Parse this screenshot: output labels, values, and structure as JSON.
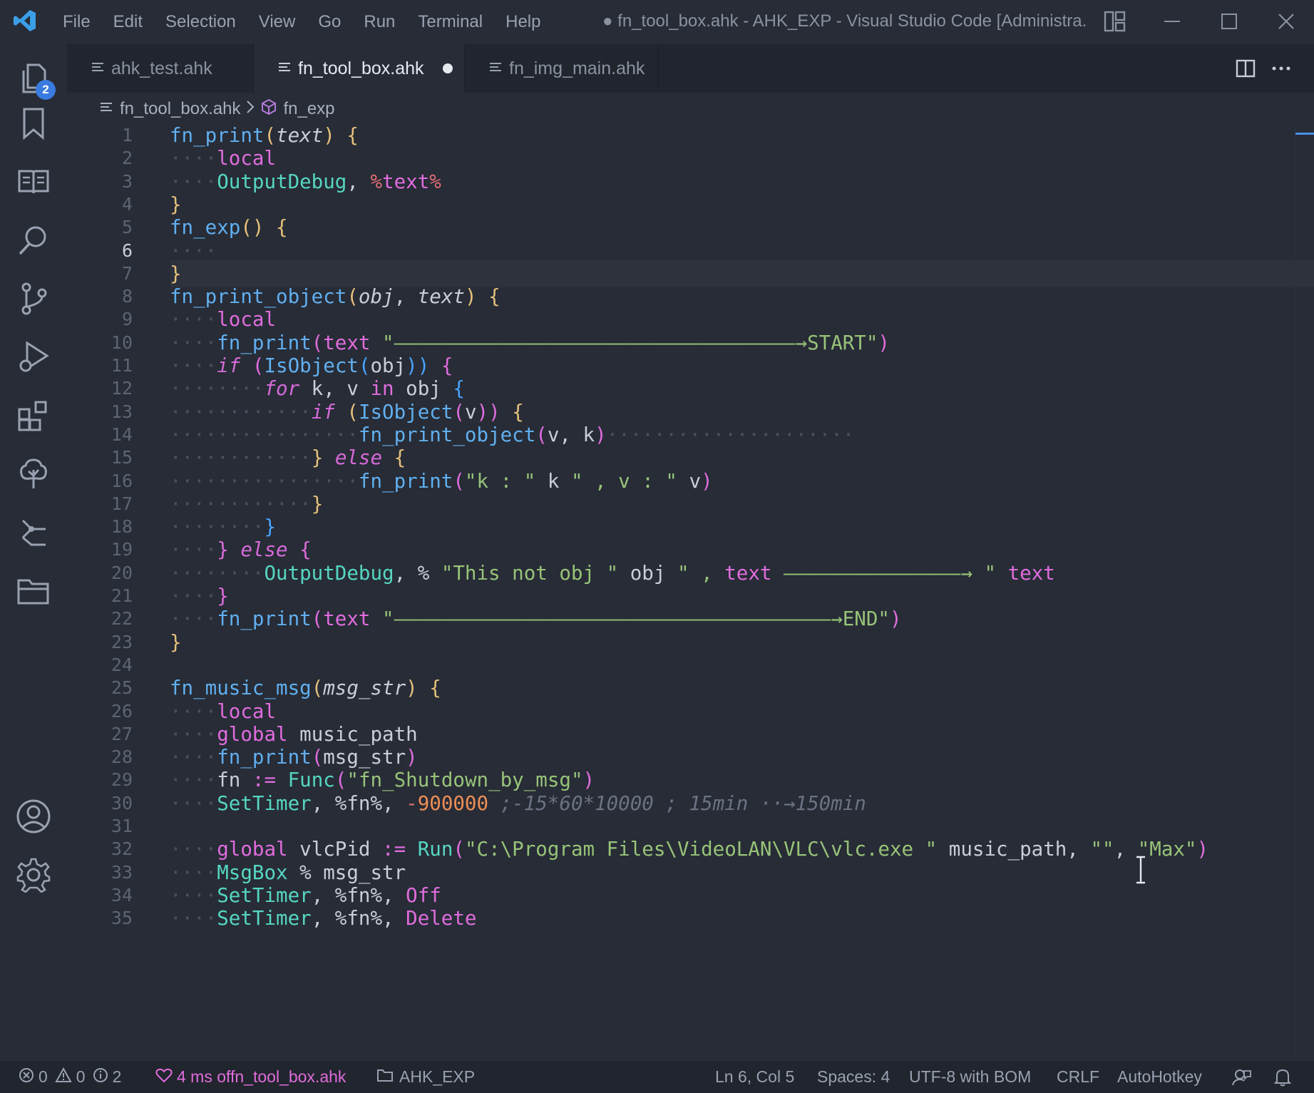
{
  "menu": [
    "File",
    "Edit",
    "Selection",
    "View",
    "Go",
    "Run",
    "Terminal",
    "Help"
  ],
  "window_title": "● fn_tool_box.ahk - AHK_EXP - Visual Studio Code [Administra...",
  "activity_badge": "2",
  "tabs": [
    {
      "label": "ahk_test.ahk",
      "dirty": false,
      "active": false
    },
    {
      "label": "fn_tool_box.ahk",
      "dirty": true,
      "active": true
    },
    {
      "label": "fn_img_main.ahk",
      "dirty": true,
      "active": false
    }
  ],
  "breadcrumb": {
    "file": "fn_tool_box.ahk",
    "symbol": "fn_exp"
  },
  "editor": {
    "current_line": 6,
    "lines": [
      {
        "n": "1",
        "segs": [
          [
            "fn_print",
            "fn"
          ],
          [
            "(",
            "pb"
          ],
          [
            "text",
            "it"
          ],
          [
            ")",
            "pb"
          ],
          [
            " ",
            ""
          ],
          [
            "{",
            "by"
          ]
        ]
      },
      {
        "n": "2",
        "segs": [
          [
            "····",
            "ws"
          ],
          [
            "local",
            "kw"
          ]
        ]
      },
      {
        "n": "3",
        "segs": [
          [
            "····",
            "ws"
          ],
          [
            "OutputDebug",
            "cmd"
          ],
          [
            ", ",
            ""
          ],
          [
            "%",
            "pn"
          ],
          [
            "text",
            "kw"
          ],
          [
            "%",
            "pn"
          ]
        ]
      },
      {
        "n": "4",
        "segs": [
          [
            "}",
            "by"
          ]
        ]
      },
      {
        "n": "5",
        "segs": [
          [
            "fn_exp",
            "fn"
          ],
          [
            "()",
            "pb"
          ],
          [
            " ",
            ""
          ],
          [
            "{",
            "by"
          ]
        ]
      },
      {
        "n": "6",
        "segs": [
          [
            "····",
            "ws"
          ]
        ]
      },
      {
        "n": "7",
        "segs": [
          [
            "}",
            "by"
          ]
        ]
      },
      {
        "n": "8",
        "segs": [
          [
            "fn_print_object",
            "fn"
          ],
          [
            "(",
            "pb"
          ],
          [
            "obj",
            "it"
          ],
          [
            ", ",
            ""
          ],
          [
            "text",
            "it"
          ],
          [
            ")",
            "pb"
          ],
          [
            " ",
            ""
          ],
          [
            "{",
            "by"
          ]
        ]
      },
      {
        "n": "9",
        "segs": [
          [
            "····",
            "ws"
          ],
          [
            "local",
            "kw"
          ]
        ]
      },
      {
        "n": "10",
        "segs": [
          [
            "····",
            "ws"
          ],
          [
            "fn_print",
            "fn"
          ],
          [
            "(",
            "pm"
          ],
          [
            "text ",
            "kw"
          ],
          [
            "\"——————————————————————————————————→START\"",
            "str"
          ],
          [
            ")",
            "pm"
          ]
        ]
      },
      {
        "n": "11",
        "segs": [
          [
            "····",
            "ws"
          ],
          [
            "if",
            "kwi"
          ],
          [
            " ",
            ""
          ],
          [
            "(",
            "pm"
          ],
          [
            "IsObject",
            "fn"
          ],
          [
            "(",
            "bb"
          ],
          [
            "obj",
            "id"
          ],
          [
            "))",
            "bb"
          ],
          [
            " ",
            ""
          ],
          [
            "{",
            "pm"
          ]
        ]
      },
      {
        "n": "12",
        "segs": [
          [
            "········",
            "ws"
          ],
          [
            "for",
            "kwi"
          ],
          [
            " k, v ",
            ""
          ],
          [
            "in",
            "kw"
          ],
          [
            " obj ",
            ""
          ],
          [
            "{",
            "bb"
          ]
        ]
      },
      {
        "n": "13",
        "segs": [
          [
            "············",
            "ws"
          ],
          [
            "if",
            "kwi"
          ],
          [
            " ",
            ""
          ],
          [
            "(",
            "by"
          ],
          [
            "IsObject",
            "fn"
          ],
          [
            "(",
            "pm"
          ],
          [
            "v",
            "id"
          ],
          [
            "))",
            "pm"
          ],
          [
            " ",
            ""
          ],
          [
            "{",
            "by"
          ]
        ]
      },
      {
        "n": "14",
        "segs": [
          [
            "················",
            "ws"
          ],
          [
            "fn_print_object",
            "fn"
          ],
          [
            "(",
            "pm"
          ],
          [
            "v, k",
            "id"
          ],
          [
            ")",
            "pm"
          ],
          [
            "·····················",
            "ws"
          ]
        ]
      },
      {
        "n": "15",
        "segs": [
          [
            "············",
            "ws"
          ],
          [
            "}",
            "by"
          ],
          [
            " ",
            ""
          ],
          [
            "else",
            "kwi"
          ],
          [
            " ",
            ""
          ],
          [
            "{",
            "by"
          ]
        ]
      },
      {
        "n": "16",
        "segs": [
          [
            "················",
            "ws"
          ],
          [
            "fn_print",
            "fn"
          ],
          [
            "(",
            "pm"
          ],
          [
            "\"k : \"",
            "str"
          ],
          [
            " k ",
            ""
          ],
          [
            "\" , v : \"",
            "str"
          ],
          [
            " v",
            ""
          ],
          [
            ")",
            "pm"
          ]
        ]
      },
      {
        "n": "17",
        "segs": [
          [
            "············",
            "ws"
          ],
          [
            "}",
            "by"
          ]
        ]
      },
      {
        "n": "18",
        "segs": [
          [
            "········",
            "ws"
          ],
          [
            "}",
            "bb"
          ]
        ]
      },
      {
        "n": "19",
        "segs": [
          [
            "····",
            "ws"
          ],
          [
            "}",
            "pm"
          ],
          [
            " ",
            ""
          ],
          [
            "else",
            "kwi"
          ],
          [
            " ",
            ""
          ],
          [
            "{",
            "pm"
          ]
        ]
      },
      {
        "n": "20",
        "segs": [
          [
            "········",
            "ws"
          ],
          [
            "OutputDebug",
            "cmd"
          ],
          [
            ", % ",
            ""
          ],
          [
            "\"This not obj \"",
            "str"
          ],
          [
            " obj ",
            ""
          ],
          [
            "\" , ",
            "str"
          ],
          [
            "text",
            "kw"
          ],
          [
            " ———————————————→ ",
            "str"
          ],
          [
            "\" ",
            "str"
          ],
          [
            "text",
            "kw"
          ]
        ]
      },
      {
        "n": "21",
        "segs": [
          [
            "····",
            "ws"
          ],
          [
            "}",
            "pm"
          ]
        ]
      },
      {
        "n": "22",
        "segs": [
          [
            "····",
            "ws"
          ],
          [
            "fn_print",
            "fn"
          ],
          [
            "(",
            "pm"
          ],
          [
            "text ",
            "kw"
          ],
          [
            "\"—————————————————————————————————————→END\"",
            "str"
          ],
          [
            ")",
            "pm"
          ]
        ]
      },
      {
        "n": "23",
        "segs": [
          [
            "}",
            "by"
          ]
        ]
      },
      {
        "n": "24",
        "segs": []
      },
      {
        "n": "25",
        "segs": [
          [
            "fn_music_msg",
            "fn"
          ],
          [
            "(",
            "pb"
          ],
          [
            "msg_str",
            "it"
          ],
          [
            ")",
            "pb"
          ],
          [
            " ",
            ""
          ],
          [
            "{",
            "by"
          ]
        ]
      },
      {
        "n": "26",
        "segs": [
          [
            "····",
            "ws"
          ],
          [
            "local",
            "kw"
          ]
        ]
      },
      {
        "n": "27",
        "segs": [
          [
            "····",
            "ws"
          ],
          [
            "global",
            "kw"
          ],
          [
            " music_path",
            ""
          ]
        ]
      },
      {
        "n": "28",
        "segs": [
          [
            "····",
            "ws"
          ],
          [
            "fn_print",
            "fn"
          ],
          [
            "(",
            "pm"
          ],
          [
            "msg_str",
            "id"
          ],
          [
            ")",
            "pm"
          ]
        ]
      },
      {
        "n": "29",
        "segs": [
          [
            "····",
            "ws"
          ],
          [
            "fn ",
            ""
          ],
          [
            ":=",
            "kw"
          ],
          [
            " ",
            ""
          ],
          [
            "Func",
            "cmd"
          ],
          [
            "(",
            "pm"
          ],
          [
            "\"fn_Shutdown_by_msg\"",
            "str"
          ],
          [
            ")",
            "pm"
          ]
        ]
      },
      {
        "n": "30",
        "segs": [
          [
            "····",
            "ws"
          ],
          [
            "SetTimer",
            "cmd"
          ],
          [
            ", %fn%, ",
            ""
          ],
          [
            "-",
            "pn"
          ],
          [
            "900000",
            "num"
          ],
          [
            " ;-15*60*10000 ; 15min ··→150min",
            "cmt"
          ]
        ]
      },
      {
        "n": "31",
        "segs": []
      },
      {
        "n": "32",
        "segs": [
          [
            "····",
            "ws"
          ],
          [
            "global",
            "kw"
          ],
          [
            " vlcPid ",
            ""
          ],
          [
            ":=",
            "kw"
          ],
          [
            " ",
            ""
          ],
          [
            "Run",
            "cmd"
          ],
          [
            "(",
            "pm"
          ],
          [
            "\"C:\\Program Files\\VideoLAN\\VLC\\vlc.exe \"",
            "str"
          ],
          [
            " music_path, ",
            ""
          ],
          [
            "\"\"",
            "str"
          ],
          [
            ", ",
            ""
          ],
          [
            "\"Max\"",
            "str"
          ],
          [
            ")",
            "pm"
          ]
        ]
      },
      {
        "n": "33",
        "segs": [
          [
            "····",
            "ws"
          ],
          [
            "MsgBox",
            "cmd"
          ],
          [
            " % msg_str",
            ""
          ]
        ]
      },
      {
        "n": "34",
        "segs": [
          [
            "····",
            "ws"
          ],
          [
            "SetTimer",
            "cmd"
          ],
          [
            ", %fn%, ",
            ""
          ],
          [
            "Off",
            "kw"
          ]
        ]
      },
      {
        "n": "35",
        "segs": [
          [
            "····",
            "ws"
          ],
          [
            "SetTimer",
            "cmd"
          ],
          [
            ", %fn%, ",
            ""
          ],
          [
            "Delete",
            "kw"
          ]
        ]
      }
    ]
  },
  "status": {
    "errors": "0",
    "warnings": "0",
    "infos": "2",
    "heart_text": "4 ms offn_tool_box.ahk",
    "folder": "AHK_EXP",
    "position": "Ln 6, Col 5",
    "spaces": "Spaces: 4",
    "encoding": "UTF-8 with BOM",
    "eol": "CRLF",
    "language": "AutoHotkey"
  },
  "colors": {
    "fn": "#61afef",
    "pb": "#e5c07b",
    "it": "#c8cdd6",
    "by": "#e5c07b",
    "kw": "#e06cdd",
    "kwi": "#d66ad9",
    "cmd": "#56d6c2",
    "str": "#98c379",
    "pm": "#e06cdd",
    "bb": "#4aa3ff",
    "id": "#c8cdd6",
    "num": "#ef8e54",
    "cmt": "#6b7282",
    "pn": "#e06c75",
    "ws": "#4a505c"
  }
}
